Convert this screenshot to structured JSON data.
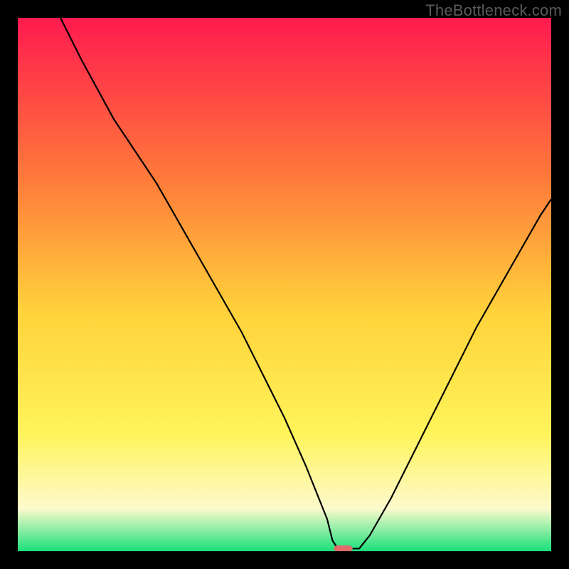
{
  "watermark": "TheBottleneck.com",
  "colors": {
    "gradient_top": "#ff1a4f",
    "gradient_mid1": "#ff7a3a",
    "gradient_mid2": "#ffd23a",
    "gradient_mid3": "#fff45a",
    "gradient_yelloWhite": "#fdfacd",
    "gradient_bottom": "#19e07a",
    "curve": "#000000",
    "marker": "#e26a6a",
    "frame": "#000000"
  },
  "chart_data": {
    "type": "line",
    "title": "",
    "xlabel": "",
    "ylabel": "",
    "xlim": [
      0,
      100
    ],
    "ylim": [
      0,
      100
    ],
    "series": [
      {
        "name": "bottleneck-curve",
        "x": [
          8,
          12,
          18,
          22,
          26,
          30,
          34,
          38,
          42,
          46,
          50,
          54,
          58,
          59,
          60,
          62,
          64,
          66,
          70,
          74,
          78,
          82,
          86,
          90,
          94,
          98,
          100
        ],
        "y": [
          100,
          92,
          81,
          75,
          69,
          62,
          55,
          48,
          41,
          33,
          25,
          16,
          6,
          2,
          0.5,
          0.5,
          0.5,
          3,
          10,
          18,
          26,
          34,
          42,
          49,
          56,
          63,
          66
        ]
      }
    ],
    "marker": {
      "x": 61,
      "y": 0.5,
      "width_pct": 3.5,
      "height_pct": 1.2
    },
    "notes": "Background is a vertical red→orange→yellow→pale-yellow→green gradient; the curve shows bottleneck % with a single minimum near x≈61 marked by a small rounded red bar. Axes have no tick labels."
  }
}
